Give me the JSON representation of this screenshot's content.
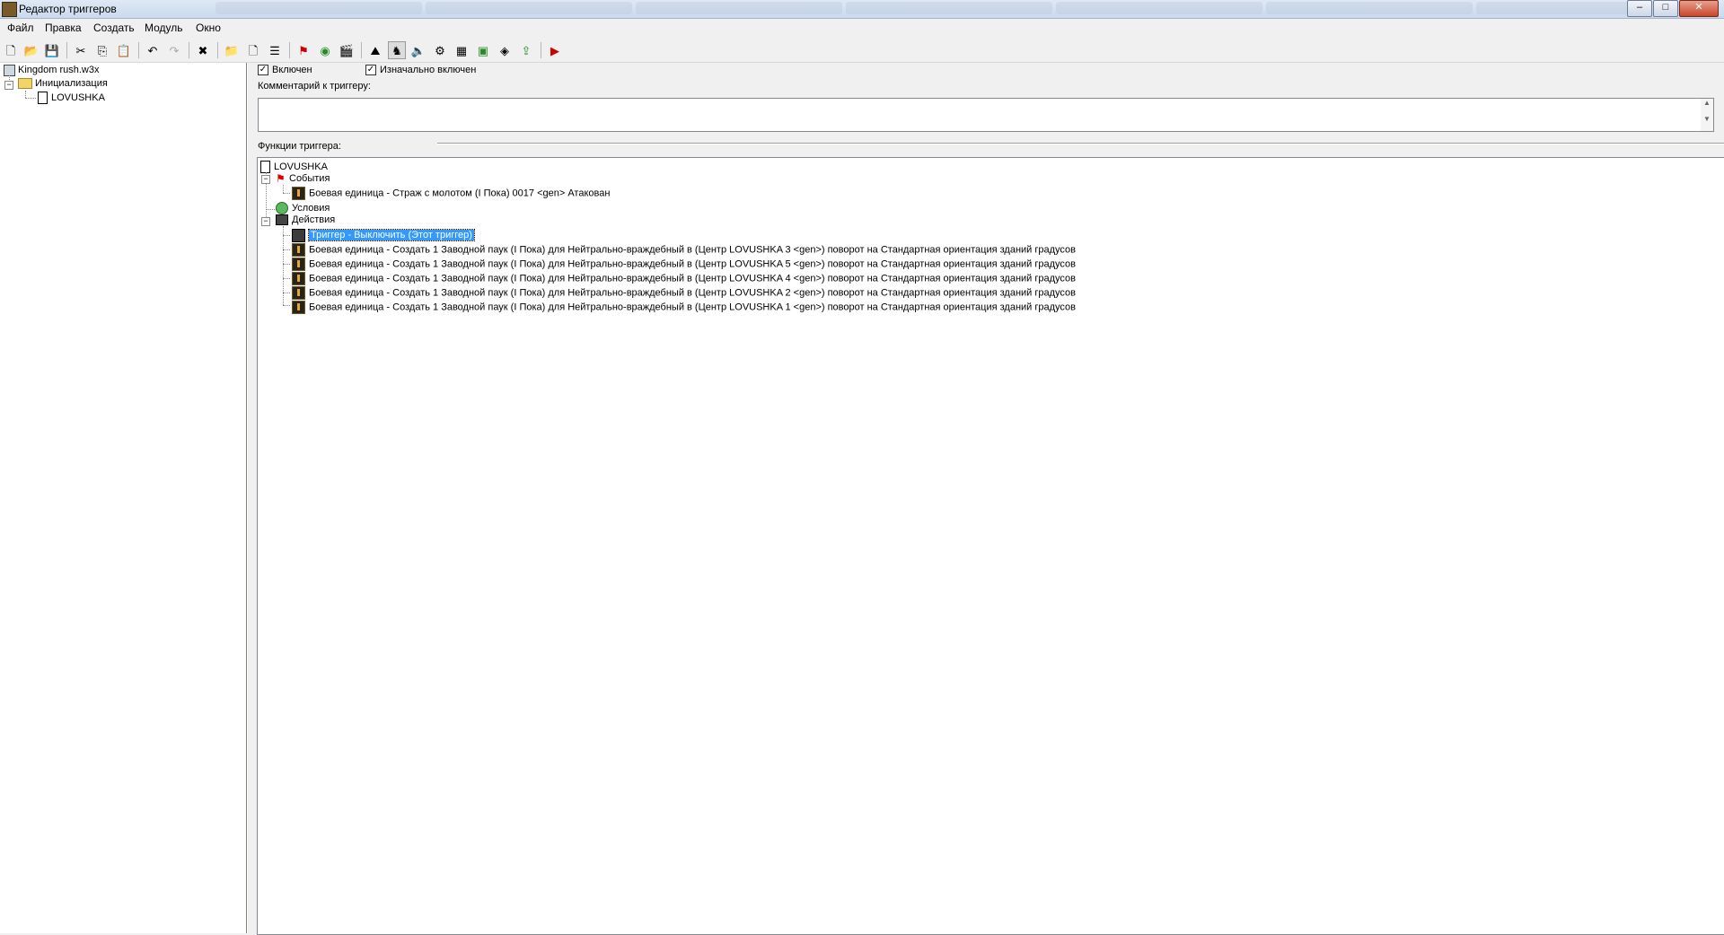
{
  "window": {
    "title": "Редактор триггеров",
    "controls": {
      "minimize": "–",
      "maximize": "□",
      "close": "✕"
    }
  },
  "menu": [
    "Файл",
    "Правка",
    "Создать",
    "Модуль",
    "Окно"
  ],
  "toolbar_icons": [
    "new-icon",
    "open-icon",
    "save-icon",
    "cut-icon",
    "copy-icon",
    "paste-icon",
    "undo-icon",
    "redo-icon",
    "delete-icon",
    "new-category-icon",
    "new-trigger-icon",
    "new-comment-icon",
    "new-event-icon",
    "new-condition-icon",
    "new-action-icon",
    "terrain-editor-icon",
    "unit-editor-icon",
    "sound-editor-icon",
    "object-editor-icon",
    "campaign-editor-icon",
    "ai-editor-icon",
    "object-manager-icon",
    "import-manager-icon",
    "test-map-icon"
  ],
  "left_tree": {
    "map": "Kingdom rush.w3x",
    "category": "Инициализация",
    "trigger": "LOVUSHKA"
  },
  "trigger_panel": {
    "enabled_label": "Включен",
    "enabled_checked": true,
    "initially_on_label": "Изначально включен",
    "initially_on_checked": true,
    "comment_label": "Комментарий к триггеру:",
    "comment_value": "",
    "functions_label": "Функции триггера:"
  },
  "functions": {
    "root": "LOVUSHKA",
    "events_label": "События",
    "events": [
      "Боевая единица - Страж с молотом (I Пока) 0017 <gen> Атакован"
    ],
    "conditions_label": "Условия",
    "actions_label": "Действия",
    "actions": [
      "Триггер - Выключить (Этот триггер)",
      "Боевая единица - Создать 1 Заводной паук (I Пока) для Нейтрально-враждебный в (Центр LOVUSHKA 3 <gen>) поворот на Стандартная ориентация зданий градусов",
      "Боевая единица - Создать 1 Заводной паук (I Пока) для Нейтрально-враждебный в (Центр LOVUSHKA 5 <gen>) поворот на Стандартная ориентация зданий градусов",
      "Боевая единица - Создать 1 Заводной паук (I Пока) для Нейтрально-враждебный в (Центр LOVUSHKA 4 <gen>) поворот на Стандартная ориентация зданий градусов",
      "Боевая единица - Создать 1 Заводной паук (I Пока) для Нейтрально-враждебный в (Центр LOVUSHKA 2 <gen>) поворот на Стандартная ориентация зданий градусов",
      "Боевая единица - Создать 1 Заводной паук (I Пока) для Нейтрально-враждебный в (Центр LOVUSHKA 1 <gen>) поворот на Стандартная ориентация зданий градусов"
    ]
  }
}
